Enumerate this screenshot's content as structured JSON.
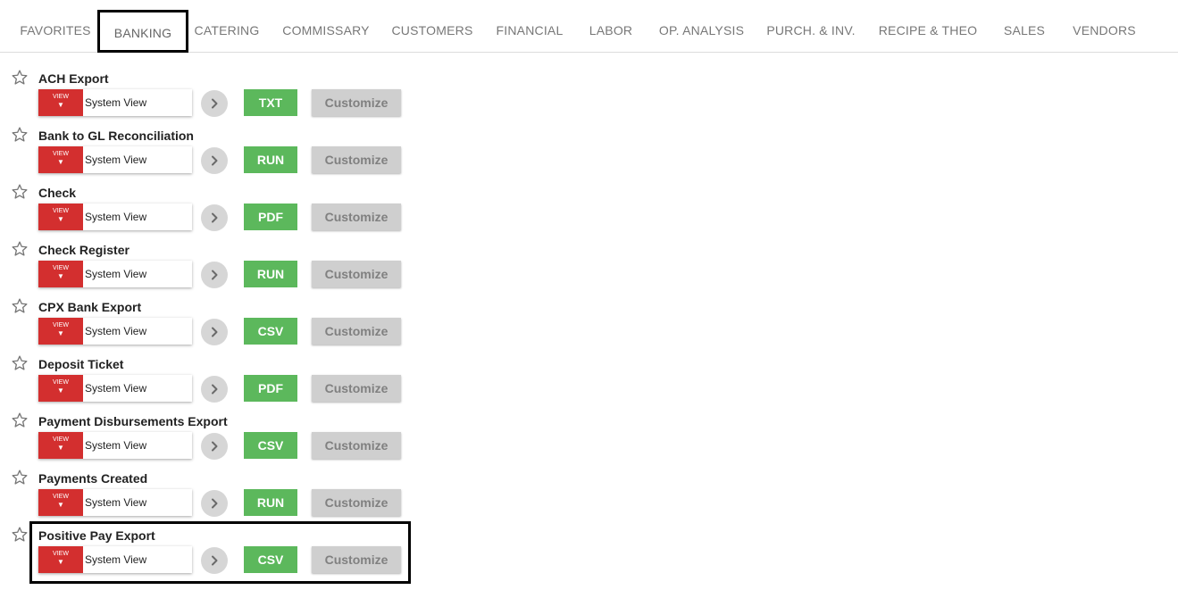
{
  "nav": {
    "tabs": [
      {
        "label": "FAVORITES"
      },
      {
        "label": "BANKING"
      },
      {
        "label": "CATERING"
      },
      {
        "label": "COMMISSARY"
      },
      {
        "label": "CUSTOMERS"
      },
      {
        "label": "FINANCIAL"
      },
      {
        "label": "LABOR"
      },
      {
        "label": "OP. ANALYSIS"
      },
      {
        "label": "PURCH. & INV."
      },
      {
        "label": "RECIPE & THEO"
      },
      {
        "label": "SALES"
      },
      {
        "label": "VENDORS"
      }
    ],
    "active_tab": "BANKING"
  },
  "reports": [
    {
      "title": "ACH Export",
      "view_label": "VIEW",
      "view": "System View",
      "action": "TXT",
      "customize": "Customize",
      "starred": false
    },
    {
      "title": "Bank to GL Reconciliation",
      "view_label": "VIEW",
      "view": "System View",
      "action": "RUN",
      "customize": "Customize",
      "starred": false
    },
    {
      "title": "Check",
      "view_label": "VIEW",
      "view": "System View",
      "action": "PDF",
      "customize": "Customize",
      "starred": false
    },
    {
      "title": "Check Register",
      "view_label": "VIEW",
      "view": "System View",
      "action": "RUN",
      "customize": "Customize",
      "starred": false
    },
    {
      "title": "CPX Bank Export",
      "view_label": "VIEW",
      "view": "System View",
      "action": "CSV",
      "customize": "Customize",
      "starred": false
    },
    {
      "title": "Deposit Ticket",
      "view_label": "VIEW",
      "view": "System View",
      "action": "PDF",
      "customize": "Customize",
      "starred": false
    },
    {
      "title": "Payment Disbursements Export",
      "view_label": "VIEW",
      "view": "System View",
      "action": "CSV",
      "customize": "Customize",
      "starred": false
    },
    {
      "title": "Payments Created",
      "view_label": "VIEW",
      "view": "System View",
      "action": "RUN",
      "customize": "Customize",
      "starred": false
    },
    {
      "title": "Positive Pay Export",
      "view_label": "VIEW",
      "view": "System View",
      "action": "CSV",
      "customize": "Customize",
      "starred": false
    }
  ],
  "icons": {
    "star": "star-outline-icon",
    "go": "chevron-right-icon",
    "view_arrow": "caret-down-icon"
  },
  "colors": {
    "view_button": "#d32f2f",
    "action_button": "#5cb85c",
    "customize_button": "#cfcfcf",
    "go_button": "#d6d6d6"
  }
}
